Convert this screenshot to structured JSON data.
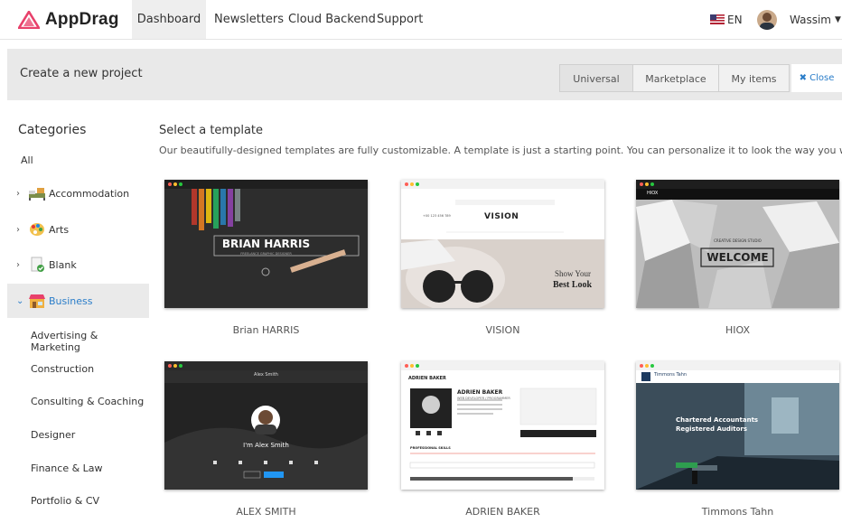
{
  "brand": {
    "name": "AppDrag",
    "accent": "#e8416b"
  },
  "nav": {
    "items": [
      "Dashboard",
      "Newsletters",
      "Cloud Backend",
      "Support"
    ],
    "active": "Dashboard"
  },
  "lang": {
    "code": "EN"
  },
  "user": {
    "name": "Wassim"
  },
  "subheader": {
    "title": "Create a new project",
    "segments": [
      "Universal",
      "Marketplace",
      "My items"
    ],
    "active_segment": "Universal",
    "close_label": "Close"
  },
  "sidebar": {
    "heading": "Categories",
    "all_label": "All",
    "categories": [
      {
        "label": "Accommodation",
        "icon": "bed-icon"
      },
      {
        "label": "Arts",
        "icon": "palette-icon"
      },
      {
        "label": "Blank",
        "icon": "blank-page-icon"
      },
      {
        "label": "Business",
        "icon": "shop-icon"
      }
    ],
    "active_category": "Business",
    "subcategories": [
      "Advertising & Marketing",
      "Construction",
      "Consulting & Coaching",
      "Designer",
      "Finance & Law",
      "Portfolio & CV"
    ]
  },
  "main": {
    "title": "Select a template",
    "description": "Our beautifully-designed templates are fully customizable. A template is just a starting point. You can personalize it to look the way you want."
  },
  "templates": [
    {
      "name": "Brian HARRIS",
      "preview_heading": "BRIAN HARRIS",
      "preview_sub": "FREELANCE GRAPHIC DESIGNER"
    },
    {
      "name": "VISION",
      "preview_heading": "VISION",
      "preview_sub": "Show Your",
      "preview_sub2": "Best Look",
      "preview_phone": "+00 123 456 789"
    },
    {
      "name": "HIOX",
      "preview_heading": "WELCOME",
      "preview_sub": "CREATIVE DESIGN STUDIO",
      "preview_brand": "HIOX"
    },
    {
      "name": "ALEX SMITH",
      "preview_heading": "I'm Alex Smith",
      "preview_brand": "Alex Smith"
    },
    {
      "name": "ADRIEN BAKER",
      "preview_heading": "ADRIEN BAKER",
      "preview_sub": "WEB DEVELOPER / PROGRAMMER",
      "preview_brand": "ADRIEN BAKER",
      "preview_section": "PROFESSIONAL SKILLS"
    },
    {
      "name": "Timmons Tahn",
      "preview_heading": "Chartered Accountants",
      "preview_sub": "Registered Auditors",
      "preview_brand": "Timmons Tahn"
    }
  ]
}
